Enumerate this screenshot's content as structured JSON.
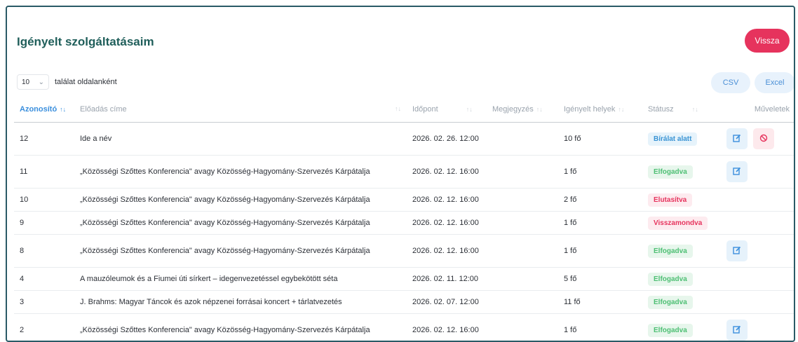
{
  "page": {
    "title": "Igényelt szolgáltatásaim",
    "back_label": "Vissza"
  },
  "toolbar": {
    "page_size": "10",
    "page_size_label": "találat oldalanként",
    "csv_label": "CSV",
    "excel_label": "Excel"
  },
  "table": {
    "columns": [
      "Azonosító",
      "Előadás címe",
      "Időpont",
      "Megjegyzés",
      "Igényelt helyek",
      "Státusz",
      "Műveletek"
    ],
    "rows": [
      {
        "id": "12",
        "title": "Ide a név",
        "time": "2026. 02. 26. 12:00",
        "note": "",
        "seats": "10 fő",
        "status": "Bírálat alatt",
        "status_type": "review",
        "edit": true,
        "cancel": true
      },
      {
        "id": "11",
        "title": "„Közösségi Szőttes Konferencia\" avagy Közösség-Hagyomány-Szervezés Kárpátalja",
        "time": "2026. 02. 12. 16:00",
        "note": "",
        "seats": "1 fő",
        "status": "Elfogadva",
        "status_type": "ok",
        "edit": true,
        "cancel": false
      },
      {
        "id": "10",
        "title": "„Közösségi Szőttes Konferencia\" avagy Közösség-Hagyomány-Szervezés Kárpátalja",
        "time": "2026. 02. 12. 16:00",
        "note": "",
        "seats": "2 fő",
        "status": "Elutasítva",
        "status_type": "rej",
        "edit": false,
        "cancel": false
      },
      {
        "id": "9",
        "title": "„Közösségi Szőttes Konferencia\" avagy Közösség-Hagyomány-Szervezés Kárpátalja",
        "time": "2026. 02. 12. 16:00",
        "note": "",
        "seats": "1 fő",
        "status": "Visszamondva",
        "status_type": "rej",
        "edit": false,
        "cancel": false
      },
      {
        "id": "8",
        "title": "„Közösségi Szőttes Konferencia\" avagy Közösség-Hagyomány-Szervezés Kárpátalja",
        "time": "2026. 02. 12. 16:00",
        "note": "",
        "seats": "1 fő",
        "status": "Elfogadva",
        "status_type": "ok",
        "edit": true,
        "cancel": false
      },
      {
        "id": "4",
        "title": "A mauzóleumok és a Fiumei úti sírkert – idegenvezetéssel egybekötött séta",
        "time": "2026. 02. 11. 12:00",
        "note": "",
        "seats": "5 fő",
        "status": "Elfogadva",
        "status_type": "ok",
        "edit": false,
        "cancel": false
      },
      {
        "id": "3",
        "title": "J. Brahms: Magyar Táncok és azok népzenei forrásai koncert + tárlatvezetés",
        "time": "2026. 02. 07. 12:00",
        "note": "",
        "seats": "11 fő",
        "status": "Elfogadva",
        "status_type": "ok",
        "edit": false,
        "cancel": false
      },
      {
        "id": "2",
        "title": "„Közösségi Szőttes Konferencia\" avagy Közösség-Hagyomány-Szervezés Kárpátalja",
        "time": "2026. 02. 12. 16:00",
        "note": "",
        "seats": "1 fő",
        "status": "Elfogadva",
        "status_type": "ok",
        "edit": true,
        "cancel": false
      }
    ]
  },
  "colors": {
    "accent": "#3b8fdd",
    "danger": "#e6335d",
    "title": "#1f5e5a",
    "ok": "#4dbf73"
  }
}
